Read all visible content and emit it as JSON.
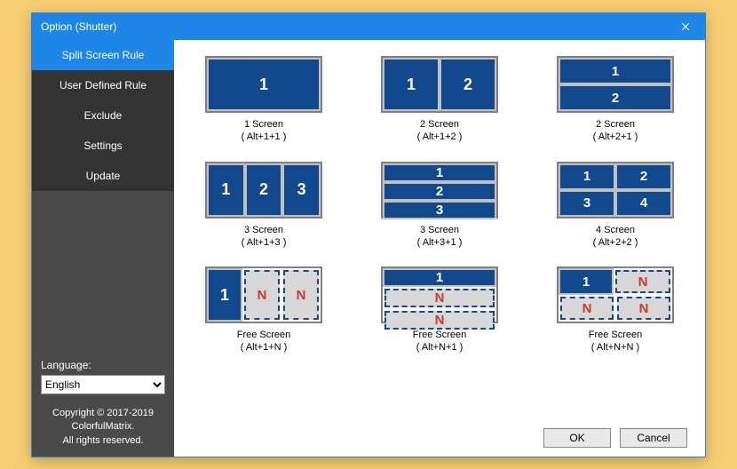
{
  "titlebar": {
    "title": "Option (Shutter)"
  },
  "sidebar": {
    "items": [
      {
        "label": "Split Screen Rule",
        "active": true
      },
      {
        "label": "User Defined Rule",
        "active": false
      },
      {
        "label": "Exclude",
        "active": false
      },
      {
        "label": "Settings",
        "active": false
      },
      {
        "label": "Update",
        "active": false
      }
    ],
    "language_label": "Language:",
    "language_value": "English",
    "copyright_line1": "Copyright © 2017-2019",
    "copyright_line2": "ColorfulMatrix.",
    "copyright_line3": "All rights reserved."
  },
  "rules": [
    {
      "title": "1 Screen",
      "shortcut": "( Alt+1+1 )"
    },
    {
      "title": "2 Screen",
      "shortcut": "( Alt+1+2 )"
    },
    {
      "title": "2 Screen",
      "shortcut": "( Alt+2+1 )"
    },
    {
      "title": "3 Screen",
      "shortcut": "( Alt+1+3 )"
    },
    {
      "title": "3 Screen",
      "shortcut": "( Alt+3+1 )"
    },
    {
      "title": "4 Screen",
      "shortcut": "( Alt+2+2 )"
    },
    {
      "title": "Free Screen",
      "shortcut": "( Alt+1+N )"
    },
    {
      "title": "Free Screen",
      "shortcut": "( Alt+N+1 )"
    },
    {
      "title": "Free Screen",
      "shortcut": "( Alt+N+N )"
    }
  ],
  "buttons": {
    "ok": "OK",
    "cancel": "Cancel"
  },
  "digits": {
    "d1": "1",
    "d2": "2",
    "d3": "3",
    "d4": "4",
    "N": "N"
  }
}
